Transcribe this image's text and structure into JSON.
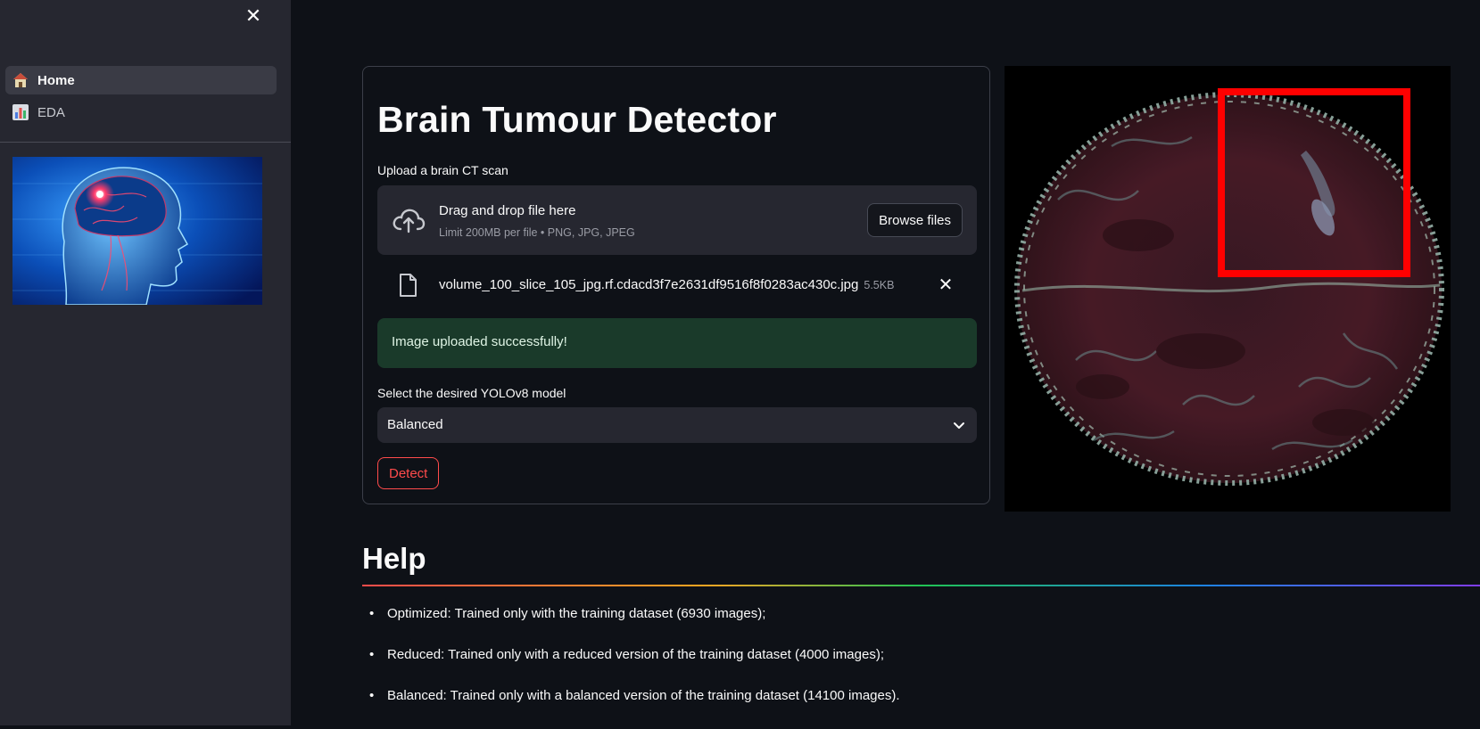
{
  "sidebar": {
    "close_icon": "close-icon",
    "nav": [
      {
        "label": "Home",
        "icon": "house-icon",
        "active": true
      },
      {
        "label": "EDA",
        "icon": "bar-chart-icon",
        "active": false
      }
    ],
    "image_alt": "brain illustration"
  },
  "main": {
    "title": "Brain Tumour Detector",
    "upload": {
      "label": "Upload a brain CT scan",
      "dropzone_title": "Drag and drop file here",
      "dropzone_limit": "Limit 200MB per file • PNG, JPG, JPEG",
      "browse_label": "Browse files"
    },
    "file": {
      "name": "volume_100_slice_105_jpg.rf.cdacd3f7e2631df9516f8f0283ac430c.jpg",
      "size": "5.5KB"
    },
    "success_message": "Image uploaded successfully!",
    "model_select": {
      "label": "Select the desired YOLOv8 model",
      "value": "Balanced"
    },
    "detect_label": "Detect"
  },
  "help": {
    "title": "Help",
    "items": [
      "Optimized: Trained only with the training dataset (6930 images);",
      "Reduced: Trained only with a reduced version of the training dataset (4000 images);",
      "Balanced: Trained only with a balanced version of the training dataset (14100 images)."
    ]
  },
  "colors": {
    "background": "#0e1117",
    "sidebar": "#262730",
    "accent": "#ff4b4b",
    "success_bg": "#1a3a2a",
    "detection_box": "#ff0000"
  }
}
